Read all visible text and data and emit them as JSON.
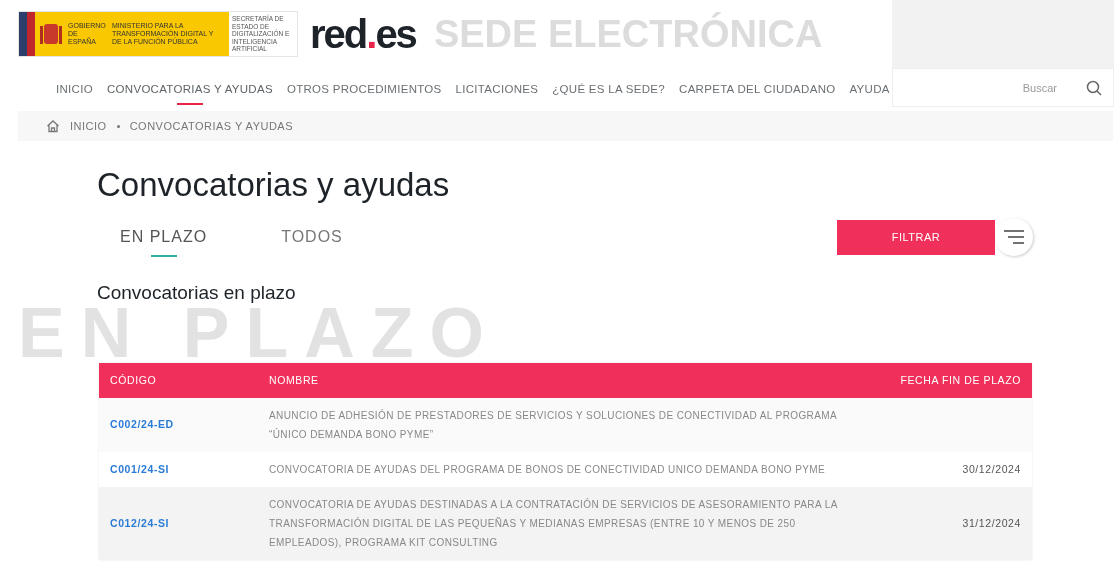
{
  "header": {
    "logo_lines": [
      "GOBIERNO DE ESPAÑA",
      "MINISTERIO PARA LA TRANSFORMACIÓN DIGITAL Y DE LA FUNCIÓN PÚBLICA",
      "SECRETARÍA DE ESTADO DE DIGITALIZACIÓN E INTELIGENCIA ARTIFICIAL"
    ],
    "brand": "red",
    "brand_dot": ".",
    "brand_tld": "es",
    "site_title": "SEDE ELECTRÓNICA"
  },
  "nav": [
    {
      "label": "INICIO",
      "selected": false
    },
    {
      "label": "CONVOCATORIAS Y AYUDAS",
      "selected": true
    },
    {
      "label": "OTROS PROCEDIMIENTOS",
      "selected": false
    },
    {
      "label": "LICITACIONES",
      "selected": false
    },
    {
      "label": "¿QUÉ ES LA SEDE?",
      "selected": false
    },
    {
      "label": "CARPETA DEL CIUDADANO",
      "selected": false
    },
    {
      "label": "AYUDA",
      "selected": false
    }
  ],
  "search": {
    "placeholder": "Buscar"
  },
  "breadcrumb": [
    "INICIO",
    "CONVOCATORIAS Y AYUDAS"
  ],
  "page_title": "Convocatorias y ayudas",
  "tabs": [
    {
      "label": "EN PLAZO",
      "selected": true
    },
    {
      "label": "TODOS",
      "selected": false
    }
  ],
  "filter_button": "FILTRAR",
  "section": {
    "watermark": "EN PLAZO",
    "title": "Convocatorias en plazo"
  },
  "table": {
    "columns": [
      "CÓDIGO",
      "NOMBRE",
      "FECHA FIN DE PLAZO"
    ],
    "rows": [
      {
        "code": "C002/24-ED",
        "name": "ANUNCIO DE ADHESIÓN DE PRESTADORES DE SERVICIOS Y SOLUCIONES DE CONECTIVIDAD AL PROGRAMA “ÚNICO DEMANDA BONO PYME”"
      },
      {
        "code": "C001/24-SI",
        "name": "CONVOCATORIA DE AYUDAS DEL PROGRAMA DE BONOS DE CONECTIVIDAD UNICO DEMANDA BONO PYME",
        "date": "30/12/2024"
      },
      {
        "code": "C012/24-SI",
        "name": "CONVOCATORIA DE AYUDAS DESTINADAS A LA CONTRATACIÓN DE SERVICIOS DE ASESORAMIENTO PARA LA TRANSFORMACIÓN DIGITAL DE LAS PEQUEÑAS Y MEDIANAS EMPRESAS (ENTRE 10 Y MENOS DE 250 EMPLEADOS), PROGRAMA KIT CONSULTING",
        "date": "31/12/2024"
      }
    ]
  }
}
